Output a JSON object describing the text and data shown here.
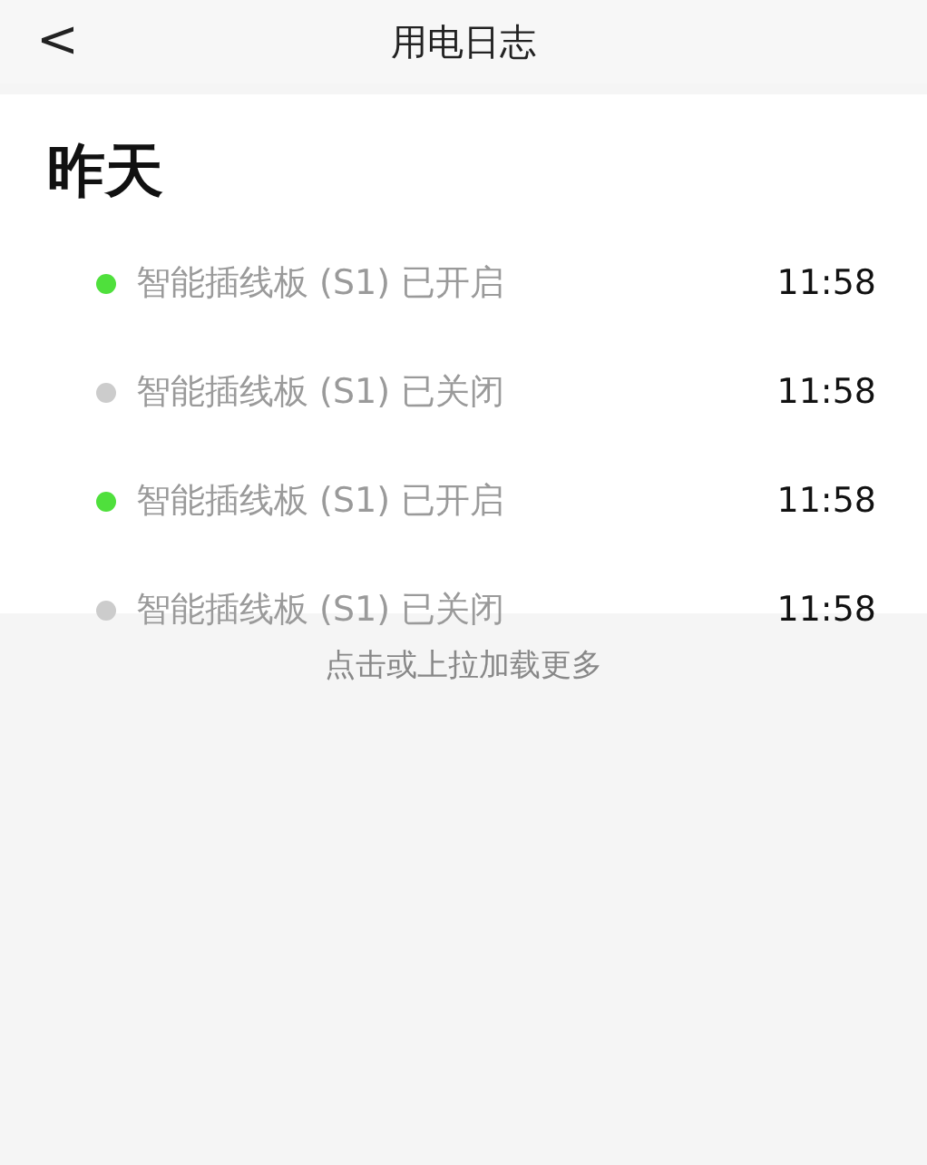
{
  "header": {
    "back": "<",
    "title": "用电日志"
  },
  "section": {
    "title": "昨天"
  },
  "logs": [
    {
      "text": "智能插线板 (S1) 已开启",
      "time": "11:58",
      "color": "#4fe03c"
    },
    {
      "text": "智能插线板 (S1) 已关闭",
      "time": "11:58",
      "color": "#cccccc"
    },
    {
      "text": "智能插线板 (S1) 已开启",
      "time": "11:58",
      "color": "#4fe03c"
    },
    {
      "text": "智能插线板 (S1) 已关闭",
      "time": "11:58",
      "color": "#cccccc"
    }
  ],
  "load_more": "点击或上拉加载更多"
}
